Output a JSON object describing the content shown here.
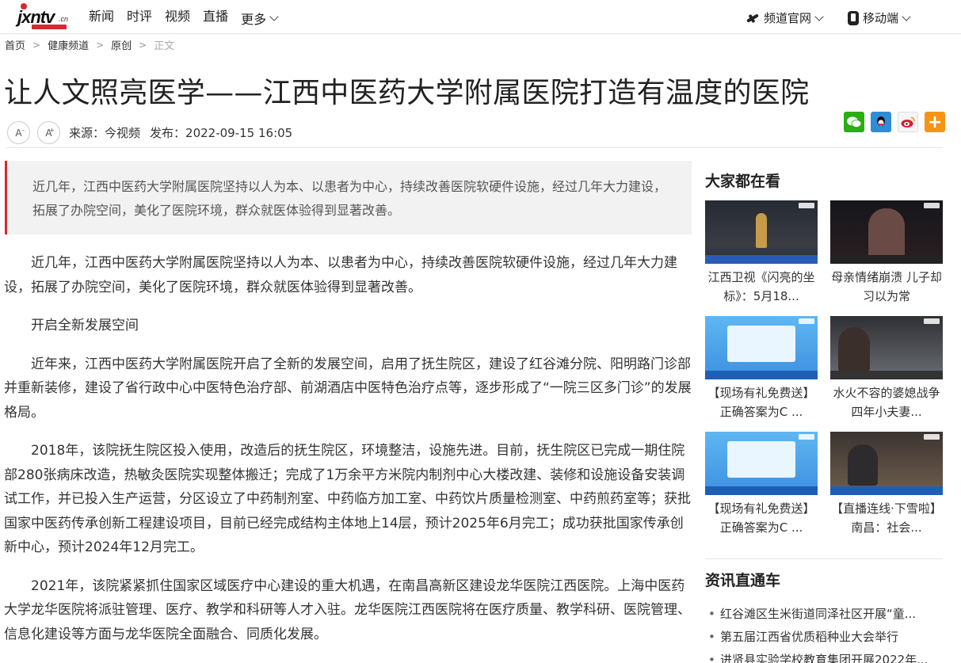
{
  "nav": {
    "logo_text": "jxntv",
    "logo_cn": ".cn",
    "links": [
      "新闻",
      "时评",
      "视频",
      "直播"
    ],
    "more": "更多",
    "channel": "频道官网",
    "mobile": "移动端"
  },
  "breadcrumb": [
    "首页",
    "健康频道",
    "原创",
    "正文"
  ],
  "article": {
    "title": "让人文照亮医学——江西中医药大学附属医院打造有温度的医院",
    "font_small": "A",
    "font_large": "A",
    "source_label": "来源：",
    "source": "今视频",
    "publish_label": "发布：",
    "publish_time": "2022-09-15 16:05",
    "summary": "近几年，江西中医药大学附属医院坚持以人为本、以患者为中心，持续改善医院软硬件设施，经过几年大力建设，拓展了办院空间，美化了医院环境，群众就医体验得到显著改善。",
    "paragraphs": [
      "近几年，江西中医药大学附属医院坚持以人为本、以患者为中心，持续改善医院软硬件设施，经过几年大力建设，拓展了办院空间，美化了医院环境，群众就医体验得到显著改善。",
      "开启全新发展空间",
      "近年来，江西中医药大学附属医院开启了全新的发展空间，启用了抚生院区，建设了红谷滩分院、阳明路门诊部并重新装修，建设了省行政中心中医特色治疗部、前湖酒店中医特色治疗点等，逐步形成了“一院三区多门诊”的发展格局。",
      "2018年，该院抚生院区投入使用，改造后的抚生院区，环境整洁，设施先进。目前，抚生院区已完成一期住院部280张病床改造，热敏灸医院实现整体搬迁；完成了1万余平方米院内制剂中心大楼改建、装修和设施设备安装调试工作，并已投入生产运营，分区设立了中药制剂室、中药临方加工室、中药饮片质量检测室、中药煎药室等；获批国家中医药传承创新工程建设项目，目前已经完成结构主体地上14层，预计2025年6月完工；成功获批国家传承创新中心，预计2024年12月完工。",
      "2021年，该院紧紧抓住国家区域医疗中心建设的重大机遇，在南昌高新区建设龙华医院江西医院。上海中医药大学龙华医院将派驻管理、医疗、教学和科研等人才入驻。龙华医院江西医院将在医疗质量、教学科研、医院管理、信息化建设等方面与龙华医院全面融合、同质化发展。"
    ]
  },
  "share": {
    "wechat": "wechat-icon",
    "qq": "qq-icon",
    "weibo": "weibo-icon",
    "more": "+"
  },
  "sidebar": {
    "popular_title": "大家都在看",
    "popular": [
      {
        "caption": "江西卫视《闪亮的坐标》：5月18..."
      },
      {
        "caption": "母亲情绪崩溃 儿子却习以为常"
      },
      {
        "caption": "【现场有礼免费送】正确答案为C ..."
      },
      {
        "caption": "水火不容的婆媳战争 四年小夫妻..."
      },
      {
        "caption": "【现场有礼免费送】正确答案为C ..."
      },
      {
        "caption": "【直播连线·下雪啦】南昌：社会..."
      }
    ],
    "news_title": "资讯直通车",
    "news": [
      "红谷滩区生米街道同泽社区开展“童...",
      "第五届江西省优质稻种业大会举行",
      "进贤县实验学校教育集团开展2022年..."
    ]
  },
  "colors": {
    "accent": "#d7282f",
    "wechat": "#2bad13",
    "qq": "#2f8cd8",
    "more": "#f59416"
  }
}
